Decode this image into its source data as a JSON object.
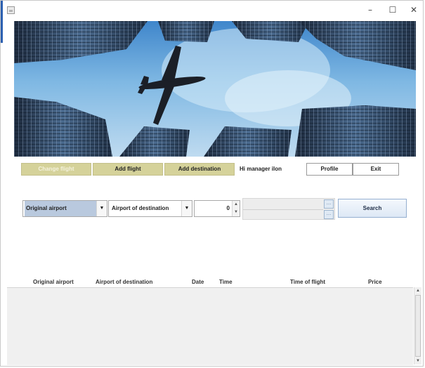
{
  "window": {
    "app_icon": "java-app-icon",
    "controls": {
      "minimize": "–",
      "maximize": "☐",
      "close": "✕"
    }
  },
  "banner": {
    "image": "airplane-over-skyscrapers"
  },
  "toolbar": {
    "change_flight": "Change flight",
    "add_flight": "Add flight",
    "add_destination": "Add destination",
    "greeting": "Hi manager ilon",
    "profile": "Profile",
    "exit": "Exit"
  },
  "search": {
    "origin": {
      "selected": "Original airport"
    },
    "destination": {
      "selected": "Airport of destination"
    },
    "passengers": {
      "value": "0"
    },
    "date": {
      "value": ""
    },
    "search_label": "Search"
  },
  "table": {
    "columns": [
      "Original airport",
      "Airport of destination",
      "Date",
      "Time",
      "Time of flight",
      "Price"
    ],
    "rows": []
  },
  "colors": {
    "toolbar_button": "#d5d29a",
    "selected_combo": "#b9c9de",
    "search_button": "#dde8f5",
    "table_body": "#f0f0f0"
  }
}
